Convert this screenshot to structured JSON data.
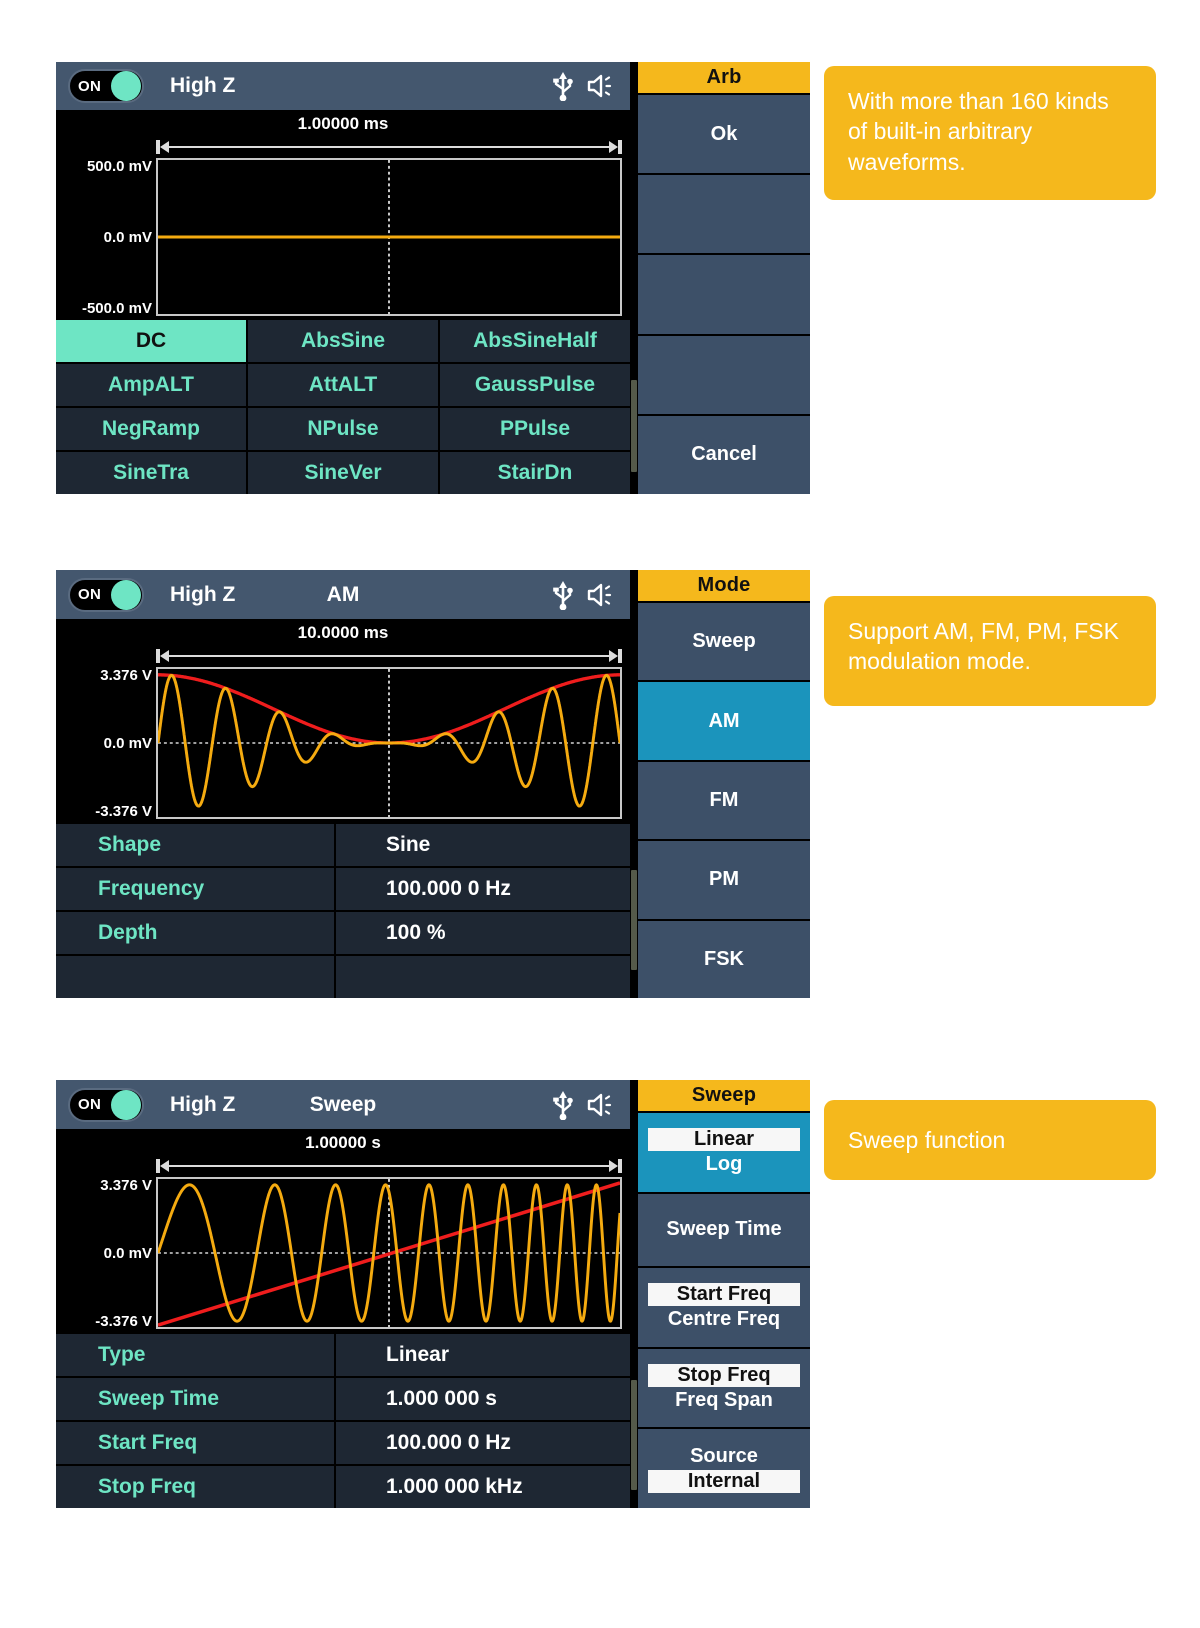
{
  "panels": [
    {
      "id": "arb",
      "header": {
        "toggle_label": "ON",
        "impedance": "High Z",
        "mode": "",
        "usb_icon": "usb-icon",
        "speaker_icon": "speaker-icon"
      },
      "plot": {
        "time_label": "1.00000 ms",
        "y_top": "500.0 mV",
        "y_mid": "0.0 mV",
        "y_bottom": "-500.0 mV"
      },
      "waveforms": [
        {
          "label": "DC",
          "selected": true
        },
        {
          "label": "AbsSine",
          "selected": false
        },
        {
          "label": "AbsSineHalf",
          "selected": false
        },
        {
          "label": "AmpALT",
          "selected": false
        },
        {
          "label": "AttALT",
          "selected": false
        },
        {
          "label": "GaussPulse",
          "selected": false
        },
        {
          "label": "NegRamp",
          "selected": false
        },
        {
          "label": "NPulse",
          "selected": false
        },
        {
          "label": "PPulse",
          "selected": false
        },
        {
          "label": "SineTra",
          "selected": false
        },
        {
          "label": "SineVer",
          "selected": false
        },
        {
          "label": "StairDn",
          "selected": false
        }
      ],
      "menu": {
        "title": "Arb",
        "buttons": [
          {
            "label": "Ok",
            "selected": false
          },
          {
            "label": "",
            "selected": false
          },
          {
            "label": "",
            "selected": false
          },
          {
            "label": "",
            "selected": false
          },
          {
            "label": "Cancel",
            "selected": false
          }
        ]
      },
      "callout": "With more than 160 kinds of built-in arbitrary waveforms."
    },
    {
      "id": "am",
      "header": {
        "toggle_label": "ON",
        "impedance": "High Z",
        "mode": "AM",
        "usb_icon": "usb-icon",
        "speaker_icon": "speaker-icon"
      },
      "plot": {
        "time_label": "10.0000 ms",
        "y_top": "3.376 V",
        "y_mid": "0.0 mV",
        "y_bottom": "-3.376 V"
      },
      "table": [
        {
          "key": "Shape",
          "value": "Sine"
        },
        {
          "key": "Frequency",
          "value": "100.000 0 Hz"
        },
        {
          "key": "Depth",
          "value": "100 %"
        },
        {
          "key": "",
          "value": ""
        }
      ],
      "menu": {
        "title": "Mode",
        "buttons": [
          {
            "label": "Sweep",
            "selected": false
          },
          {
            "label": "AM",
            "selected": true
          },
          {
            "label": "FM",
            "selected": false
          },
          {
            "label": "PM",
            "selected": false
          },
          {
            "label": "FSK",
            "selected": false
          }
        ]
      },
      "callout": "Support AM, FM, PM, FSK modulation mode."
    },
    {
      "id": "sweep",
      "header": {
        "toggle_label": "ON",
        "impedance": "High Z",
        "mode": "Sweep",
        "usb_icon": "usb-icon",
        "speaker_icon": "speaker-icon"
      },
      "plot": {
        "time_label": "1.00000 s",
        "y_top": "3.376 V",
        "y_mid": "0.0 mV",
        "y_bottom": "-3.376 V"
      },
      "table": [
        {
          "key": "Type",
          "value": "Linear"
        },
        {
          "key": "Sweep Time",
          "value": "1.000 000 s"
        },
        {
          "key": "Start Freq",
          "value": "100.000 0 Hz"
        },
        {
          "key": "Stop Freq",
          "value": "1.000 000 kHz"
        }
      ],
      "menu": {
        "title": "Sweep",
        "dual_buttons": [
          {
            "top": "Linear",
            "bottom": "Log",
            "selected_group": true,
            "active": "top"
          },
          {
            "single": "Sweep Time"
          },
          {
            "top": "Start Freq",
            "bottom": "Centre Freq",
            "active": "top"
          },
          {
            "top": "Stop Freq",
            "bottom": "Freq Span",
            "active": "top"
          },
          {
            "top": "Source",
            "bottom": "Internal",
            "active": "bottom"
          }
        ]
      },
      "callout": "Sweep function"
    }
  ],
  "colors": {
    "accent_yellow": "#f5b81c",
    "header_blue": "#44576e",
    "menu_blue": "#3d5068",
    "selected_blue": "#1b94bc",
    "mint": "#6ee5c4",
    "trace_yellow": "#f5ab10",
    "envelope_red": "#ef1d1d",
    "cell_bg": "#1e2733"
  }
}
